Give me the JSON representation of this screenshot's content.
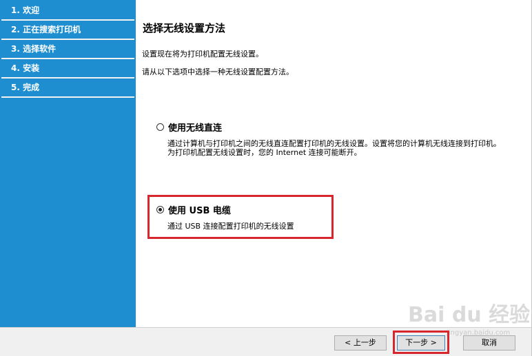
{
  "sidebar": {
    "steps": [
      {
        "label": "1. 欢迎"
      },
      {
        "label": "2. 正在搜索打印机"
      },
      {
        "label": "3. 选择软件"
      },
      {
        "label": "4. 安装"
      },
      {
        "label": "5. 完成"
      }
    ],
    "background": "#1e8ed0"
  },
  "main": {
    "title": "选择无线设置方法",
    "intro_line1": "设置现在将为打印机配置无线设置。",
    "intro_line2": "请从以下选项中选择一种无线设置配置方法。",
    "options": [
      {
        "label": "使用无线直连",
        "selected": false,
        "description_line1": "通过计算机与打印机之间的无线直连配置打印机的无线设置。设置将您的计算机无线连接到打印机。",
        "description_line2": "为打印机配置无线设置时，您的 Internet 连接可能断开。"
      },
      {
        "label": "使用 USB 电缆",
        "selected": true,
        "description_line1": "通过 USB 连接配置打印机的无线设置"
      }
    ]
  },
  "footer": {
    "back_label": "< 上一步",
    "next_label": "下一步 >",
    "cancel_label": "取消"
  },
  "watermark": {
    "text": "Bai du 经验",
    "sub": "jingyan.baidu.com"
  },
  "colors": {
    "highlight": "#d8262e",
    "accent": "#1e8ed0"
  }
}
